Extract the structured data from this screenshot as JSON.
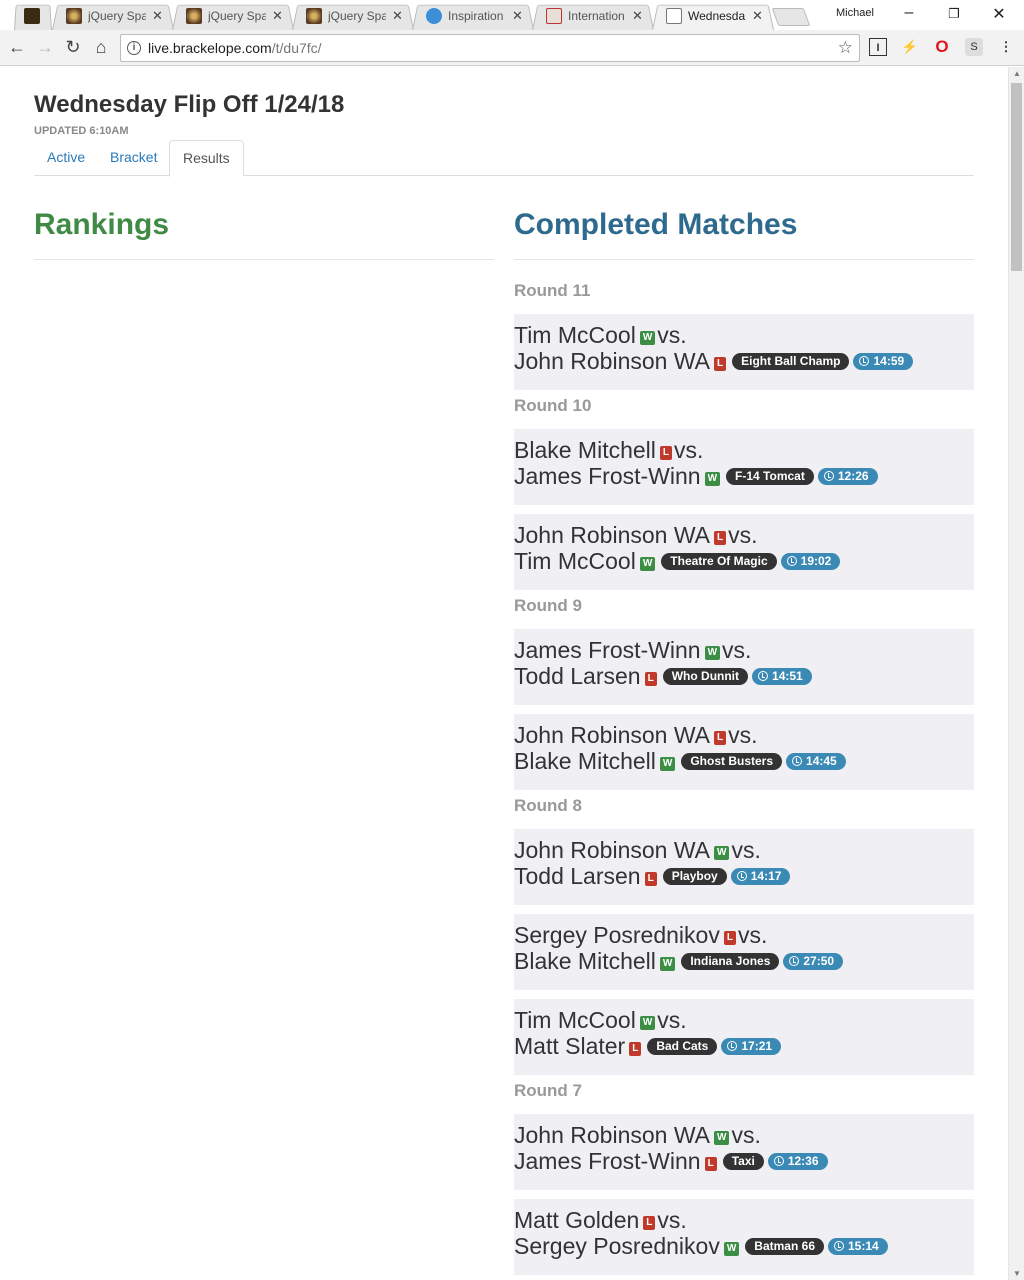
{
  "browser": {
    "tabs": [
      {
        "label": "",
        "favicon": "ig-favicon",
        "active": false
      },
      {
        "label": "jQuery Spa",
        "favicon": "jquery-favicon",
        "active": false
      },
      {
        "label": "jQuery Spa",
        "favicon": "jquery-favicon",
        "active": false
      },
      {
        "label": "jQuery Spa",
        "favicon": "jquery-favicon",
        "active": false
      },
      {
        "label": "Inspiration",
        "favicon": "inspiration-favicon",
        "active": false
      },
      {
        "label": "Internation",
        "favicon": "international-favicon",
        "active": false
      },
      {
        "label": "Wednesda",
        "favicon": "document-favicon",
        "active": true
      }
    ],
    "close_glyph": "✕",
    "user": "Michael",
    "url_host": "live.brackelope.com",
    "url_path": "/t/du7fc/"
  },
  "page": {
    "title": "Wednesday Flip Off 1/24/18",
    "updated": "UPDATED 6:10AM",
    "tabs": [
      "Active",
      "Bracket",
      "Results"
    ],
    "active_tab": "Results",
    "rankings_heading": "Rankings",
    "completed_heading": "Completed Matches",
    "vs": "vs.",
    "rounds": [
      {
        "label": "Round 11",
        "matches": [
          {
            "p1": "Tim McCool",
            "r1": "W",
            "p2": "John Robinson WA",
            "r2": "L",
            "machine": "Eight Ball Champ",
            "time": "14:59"
          }
        ]
      },
      {
        "label": "Round 10",
        "matches": [
          {
            "p1": "Blake Mitchell",
            "r1": "L",
            "p2": "James Frost-Winn",
            "r2": "W",
            "machine": "F-14 Tomcat",
            "time": "12:26"
          },
          {
            "p1": "John Robinson WA",
            "r1": "L",
            "p2": "Tim McCool",
            "r2": "W",
            "machine": "Theatre Of Magic",
            "time": "19:02"
          }
        ]
      },
      {
        "label": "Round 9",
        "matches": [
          {
            "p1": "James Frost-Winn",
            "r1": "W",
            "p2": "Todd Larsen",
            "r2": "L",
            "machine": "Who Dunnit",
            "time": "14:51"
          },
          {
            "p1": "John Robinson WA",
            "r1": "L",
            "p2": "Blake Mitchell",
            "r2": "W",
            "machine": "Ghost Busters",
            "time": "14:45"
          }
        ]
      },
      {
        "label": "Round 8",
        "matches": [
          {
            "p1": "John Robinson WA",
            "r1": "W",
            "p2": "Todd Larsen",
            "r2": "L",
            "machine": "Playboy",
            "time": "14:17"
          },
          {
            "p1": "Sergey Posrednikov",
            "r1": "L",
            "p2": "Blake Mitchell",
            "r2": "W",
            "machine": "Indiana Jones",
            "time": "27:50"
          },
          {
            "p1": "Tim McCool",
            "r1": "W",
            "p2": "Matt Slater",
            "r2": "L",
            "machine": "Bad Cats",
            "time": "17:21"
          }
        ]
      },
      {
        "label": "Round 7",
        "matches": [
          {
            "p1": "John Robinson WA",
            "r1": "W",
            "p2": "James Frost-Winn",
            "r2": "L",
            "machine": "Taxi",
            "time": "12:36"
          },
          {
            "p1": "Matt Golden",
            "r1": "L",
            "p2": "Sergey Posrednikov",
            "r2": "W",
            "machine": "Batman 66",
            "time": "15:14"
          }
        ]
      }
    ]
  }
}
